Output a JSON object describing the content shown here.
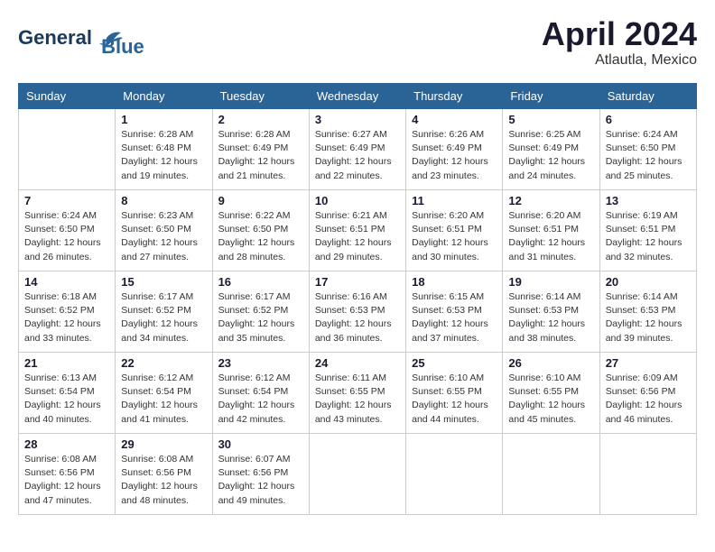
{
  "header": {
    "logo_line1": "General",
    "logo_line2": "Blue",
    "month": "April 2024",
    "location": "Atlautla, Mexico"
  },
  "weekdays": [
    "Sunday",
    "Monday",
    "Tuesday",
    "Wednesday",
    "Thursday",
    "Friday",
    "Saturday"
  ],
  "weeks": [
    [
      {
        "day": "",
        "info": ""
      },
      {
        "day": "1",
        "info": "Sunrise: 6:28 AM\nSunset: 6:48 PM\nDaylight: 12 hours\nand 19 minutes."
      },
      {
        "day": "2",
        "info": "Sunrise: 6:28 AM\nSunset: 6:49 PM\nDaylight: 12 hours\nand 21 minutes."
      },
      {
        "day": "3",
        "info": "Sunrise: 6:27 AM\nSunset: 6:49 PM\nDaylight: 12 hours\nand 22 minutes."
      },
      {
        "day": "4",
        "info": "Sunrise: 6:26 AM\nSunset: 6:49 PM\nDaylight: 12 hours\nand 23 minutes."
      },
      {
        "day": "5",
        "info": "Sunrise: 6:25 AM\nSunset: 6:49 PM\nDaylight: 12 hours\nand 24 minutes."
      },
      {
        "day": "6",
        "info": "Sunrise: 6:24 AM\nSunset: 6:50 PM\nDaylight: 12 hours\nand 25 minutes."
      }
    ],
    [
      {
        "day": "7",
        "info": "Sunrise: 6:24 AM\nSunset: 6:50 PM\nDaylight: 12 hours\nand 26 minutes."
      },
      {
        "day": "8",
        "info": "Sunrise: 6:23 AM\nSunset: 6:50 PM\nDaylight: 12 hours\nand 27 minutes."
      },
      {
        "day": "9",
        "info": "Sunrise: 6:22 AM\nSunset: 6:50 PM\nDaylight: 12 hours\nand 28 minutes."
      },
      {
        "day": "10",
        "info": "Sunrise: 6:21 AM\nSunset: 6:51 PM\nDaylight: 12 hours\nand 29 minutes."
      },
      {
        "day": "11",
        "info": "Sunrise: 6:20 AM\nSunset: 6:51 PM\nDaylight: 12 hours\nand 30 minutes."
      },
      {
        "day": "12",
        "info": "Sunrise: 6:20 AM\nSunset: 6:51 PM\nDaylight: 12 hours\nand 31 minutes."
      },
      {
        "day": "13",
        "info": "Sunrise: 6:19 AM\nSunset: 6:51 PM\nDaylight: 12 hours\nand 32 minutes."
      }
    ],
    [
      {
        "day": "14",
        "info": "Sunrise: 6:18 AM\nSunset: 6:52 PM\nDaylight: 12 hours\nand 33 minutes."
      },
      {
        "day": "15",
        "info": "Sunrise: 6:17 AM\nSunset: 6:52 PM\nDaylight: 12 hours\nand 34 minutes."
      },
      {
        "day": "16",
        "info": "Sunrise: 6:17 AM\nSunset: 6:52 PM\nDaylight: 12 hours\nand 35 minutes."
      },
      {
        "day": "17",
        "info": "Sunrise: 6:16 AM\nSunset: 6:53 PM\nDaylight: 12 hours\nand 36 minutes."
      },
      {
        "day": "18",
        "info": "Sunrise: 6:15 AM\nSunset: 6:53 PM\nDaylight: 12 hours\nand 37 minutes."
      },
      {
        "day": "19",
        "info": "Sunrise: 6:14 AM\nSunset: 6:53 PM\nDaylight: 12 hours\nand 38 minutes."
      },
      {
        "day": "20",
        "info": "Sunrise: 6:14 AM\nSunset: 6:53 PM\nDaylight: 12 hours\nand 39 minutes."
      }
    ],
    [
      {
        "day": "21",
        "info": "Sunrise: 6:13 AM\nSunset: 6:54 PM\nDaylight: 12 hours\nand 40 minutes."
      },
      {
        "day": "22",
        "info": "Sunrise: 6:12 AM\nSunset: 6:54 PM\nDaylight: 12 hours\nand 41 minutes."
      },
      {
        "day": "23",
        "info": "Sunrise: 6:12 AM\nSunset: 6:54 PM\nDaylight: 12 hours\nand 42 minutes."
      },
      {
        "day": "24",
        "info": "Sunrise: 6:11 AM\nSunset: 6:55 PM\nDaylight: 12 hours\nand 43 minutes."
      },
      {
        "day": "25",
        "info": "Sunrise: 6:10 AM\nSunset: 6:55 PM\nDaylight: 12 hours\nand 44 minutes."
      },
      {
        "day": "26",
        "info": "Sunrise: 6:10 AM\nSunset: 6:55 PM\nDaylight: 12 hours\nand 45 minutes."
      },
      {
        "day": "27",
        "info": "Sunrise: 6:09 AM\nSunset: 6:56 PM\nDaylight: 12 hours\nand 46 minutes."
      }
    ],
    [
      {
        "day": "28",
        "info": "Sunrise: 6:08 AM\nSunset: 6:56 PM\nDaylight: 12 hours\nand 47 minutes."
      },
      {
        "day": "29",
        "info": "Sunrise: 6:08 AM\nSunset: 6:56 PM\nDaylight: 12 hours\nand 48 minutes."
      },
      {
        "day": "30",
        "info": "Sunrise: 6:07 AM\nSunset: 6:56 PM\nDaylight: 12 hours\nand 49 minutes."
      },
      {
        "day": "",
        "info": ""
      },
      {
        "day": "",
        "info": ""
      },
      {
        "day": "",
        "info": ""
      },
      {
        "day": "",
        "info": ""
      }
    ]
  ]
}
